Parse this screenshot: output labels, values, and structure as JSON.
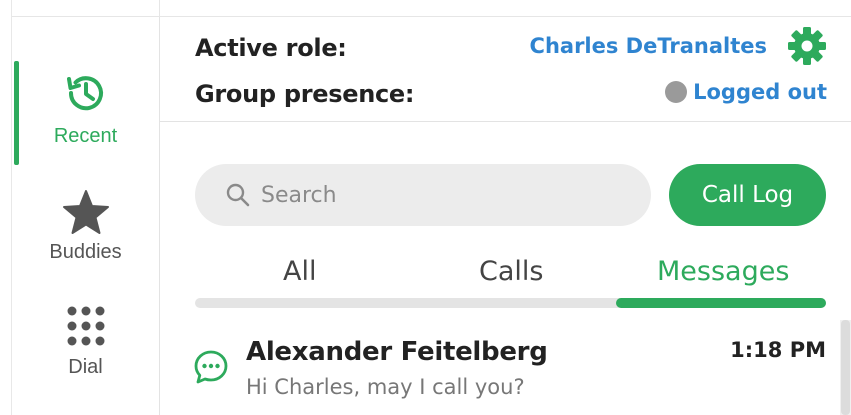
{
  "sidebar": {
    "items": [
      {
        "label": "Recent",
        "icon": "history-clock-icon"
      },
      {
        "label": "Buddies",
        "icon": "star-icon"
      },
      {
        "label": "Dial",
        "icon": "dialpad-icon"
      }
    ]
  },
  "header": {
    "active_role_label": "Active role:",
    "active_role_value": "Charles DeTranaltes",
    "group_presence_label": "Group presence:",
    "group_presence_value": "Logged out",
    "settings_icon": "gear-icon"
  },
  "search": {
    "placeholder": "Search",
    "icon": "search-icon"
  },
  "call_log_button": "Call Log",
  "tabs": [
    {
      "label": "All",
      "active": false
    },
    {
      "label": "Calls",
      "active": false
    },
    {
      "label": "Messages",
      "active": true
    }
  ],
  "messages": [
    {
      "name": "Alexander Feitelberg",
      "time": "1:18 PM",
      "preview": "Hi Charles, may I call you?",
      "icon": "chat-bubble-icon"
    }
  ],
  "colors": {
    "accent": "#2daa5c",
    "link": "#2f84d0",
    "presence_offline": "#9a9a9a"
  }
}
